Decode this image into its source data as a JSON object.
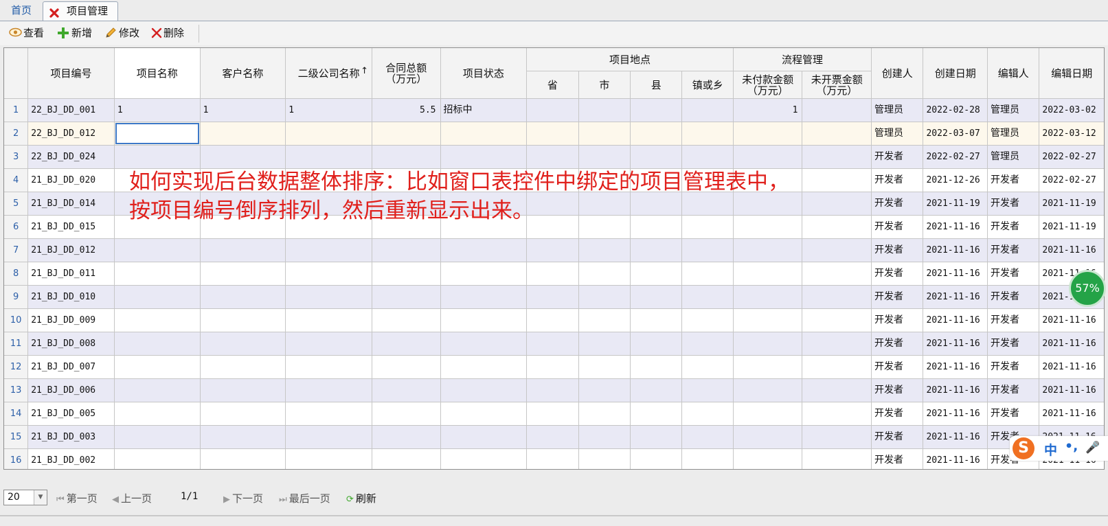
{
  "tabs": {
    "home": "首页",
    "active": "项目管理"
  },
  "toolbar": {
    "view": "查看",
    "add": "新增",
    "edit": "修改",
    "delete": "删除"
  },
  "grid": {
    "headers": {
      "project_no": "项目编号",
      "project_name": "项目名称",
      "customer_name": "客户名称",
      "sub_company": "二级公司名称",
      "sort_indicator": "↑",
      "contract_total": "合同总额",
      "contract_total_unit": "（万元）",
      "status": "项目状态",
      "location": "项目地点",
      "province": "省",
      "city": "市",
      "county": "县",
      "town": "镇或乡",
      "process": "流程管理",
      "unpaid": "未付款金额",
      "unpaid_unit": "（万元）",
      "uninvoiced": "未开票金额",
      "uninvoiced_unit": "（万元）",
      "creator": "创建人",
      "created": "创建日期",
      "editor": "编辑人",
      "edited": "编辑日期"
    },
    "rows": [
      {
        "n": "1",
        "no": "22_BJ_DD_001",
        "name": "1",
        "cust": "1",
        "sub": "1",
        "total": "5.5",
        "status": "招标中",
        "unpaid": "1",
        "creator": "管理员",
        "created": "2022-02-28",
        "editor": "管理员",
        "edited": "2022-03-02"
      },
      {
        "n": "2",
        "no": "22_BJ_DD_012",
        "name": "",
        "cust": "",
        "sub": "",
        "total": "",
        "status": "",
        "unpaid": "",
        "creator": "管理员",
        "created": "2022-03-07",
        "editor": "管理员",
        "edited": "2022-03-12"
      },
      {
        "n": "3",
        "no": "22_BJ_DD_024",
        "name": "",
        "cust": "",
        "sub": "",
        "total": "",
        "status": "",
        "unpaid": "",
        "creator": "开发者",
        "created": "2022-02-27",
        "editor": "管理员",
        "edited": "2022-02-27"
      },
      {
        "n": "4",
        "no": "21_BJ_DD_020",
        "name": "",
        "cust": "",
        "sub": "",
        "total": "",
        "status": "",
        "unpaid": "",
        "creator": "开发者",
        "created": "2021-12-26",
        "editor": "开发者",
        "edited": "2022-02-27"
      },
      {
        "n": "5",
        "no": "21_BJ_DD_014",
        "name": "",
        "cust": "",
        "sub": "",
        "total": "",
        "status": "",
        "unpaid": "",
        "creator": "开发者",
        "created": "2021-11-19",
        "editor": "开发者",
        "edited": "2021-11-19"
      },
      {
        "n": "6",
        "no": "21_BJ_DD_015",
        "name": "",
        "cust": "",
        "sub": "",
        "total": "",
        "status": "",
        "unpaid": "",
        "creator": "开发者",
        "created": "2021-11-16",
        "editor": "开发者",
        "edited": "2021-11-19"
      },
      {
        "n": "7",
        "no": "21_BJ_DD_012",
        "name": "",
        "cust": "",
        "sub": "",
        "total": "",
        "status": "",
        "unpaid": "",
        "creator": "开发者",
        "created": "2021-11-16",
        "editor": "开发者",
        "edited": "2021-11-16"
      },
      {
        "n": "8",
        "no": "21_BJ_DD_011",
        "name": "",
        "cust": "",
        "sub": "",
        "total": "",
        "status": "",
        "unpaid": "",
        "creator": "开发者",
        "created": "2021-11-16",
        "editor": "开发者",
        "edited": "2021-11-16"
      },
      {
        "n": "9",
        "no": "21_BJ_DD_010",
        "name": "",
        "cust": "",
        "sub": "",
        "total": "",
        "status": "",
        "unpaid": "",
        "creator": "开发者",
        "created": "2021-11-16",
        "editor": "开发者",
        "edited": "2021-11-16"
      },
      {
        "n": "10",
        "no": "21_BJ_DD_009",
        "name": "",
        "cust": "",
        "sub": "",
        "total": "",
        "status": "",
        "unpaid": "",
        "creator": "开发者",
        "created": "2021-11-16",
        "editor": "开发者",
        "edited": "2021-11-16"
      },
      {
        "n": "11",
        "no": "21_BJ_DD_008",
        "name": "",
        "cust": "",
        "sub": "",
        "total": "",
        "status": "",
        "unpaid": "",
        "creator": "开发者",
        "created": "2021-11-16",
        "editor": "开发者",
        "edited": "2021-11-16"
      },
      {
        "n": "12",
        "no": "21_BJ_DD_007",
        "name": "",
        "cust": "",
        "sub": "",
        "total": "",
        "status": "",
        "unpaid": "",
        "creator": "开发者",
        "created": "2021-11-16",
        "editor": "开发者",
        "edited": "2021-11-16"
      },
      {
        "n": "13",
        "no": "21_BJ_DD_006",
        "name": "",
        "cust": "",
        "sub": "",
        "total": "",
        "status": "",
        "unpaid": "",
        "creator": "开发者",
        "created": "2021-11-16",
        "editor": "开发者",
        "edited": "2021-11-16"
      },
      {
        "n": "14",
        "no": "21_BJ_DD_005",
        "name": "",
        "cust": "",
        "sub": "",
        "total": "",
        "status": "",
        "unpaid": "",
        "creator": "开发者",
        "created": "2021-11-16",
        "editor": "开发者",
        "edited": "2021-11-16"
      },
      {
        "n": "15",
        "no": "21_BJ_DD_003",
        "name": "",
        "cust": "",
        "sub": "",
        "total": "",
        "status": "",
        "unpaid": "",
        "creator": "开发者",
        "created": "2021-11-16",
        "editor": "开发者",
        "edited": "2021-11-16"
      },
      {
        "n": "16",
        "no": "21_BJ_DD_002",
        "name": "",
        "cust": "",
        "sub": "",
        "total": "",
        "status": "",
        "unpaid": "",
        "creator": "开发者",
        "created": "2021-11-16",
        "editor": "开发者",
        "edited": "2021-11-16"
      }
    ]
  },
  "annotation": {
    "line1": "如何实现后台数据整体排序：比如窗口表控件中绑定的项目管理表中，",
    "line2": "按项目编号倒序排列，然后重新显示出来。"
  },
  "badge": "57%",
  "ime": {
    "logo": "S",
    "mode": "中",
    "punct": "•,",
    "mic": "🎤"
  },
  "pager": {
    "page_size": "20",
    "first": "第一页",
    "prev": "上一页",
    "page_indicator": "1/1",
    "next": "下一页",
    "last": "最后一页",
    "refresh": "刷新"
  },
  "colors": {
    "annotation": "#e0201c",
    "row_alt": "#e9e9f5",
    "row_selected": "#fdf8ec",
    "row_number": "#2c5fa8"
  }
}
